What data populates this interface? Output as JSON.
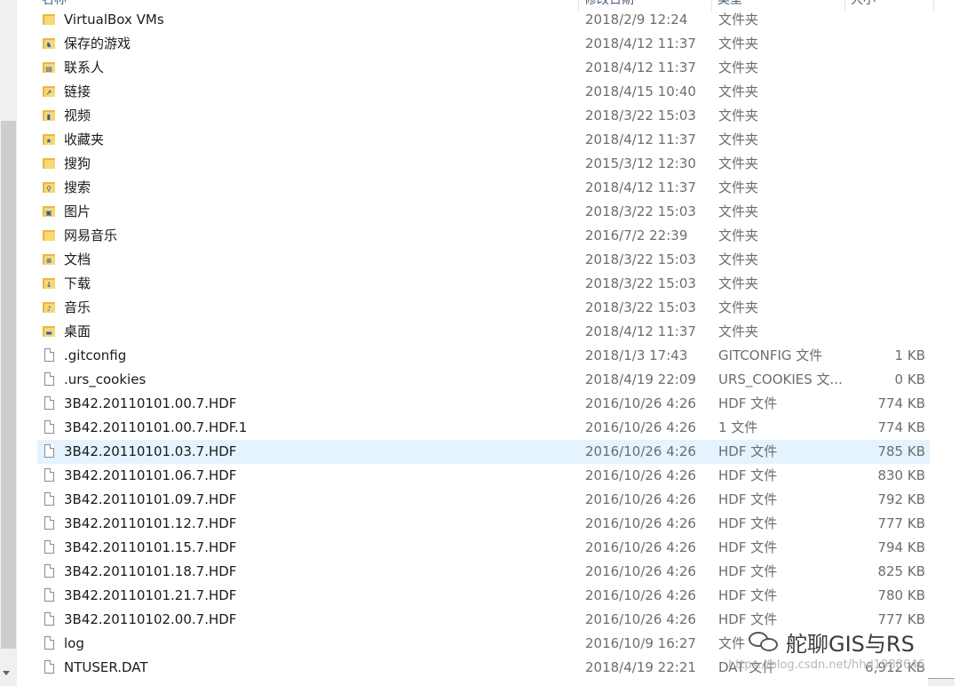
{
  "header": {
    "name": "名称",
    "date": "修改日期",
    "type": "类型",
    "size": "大小"
  },
  "rows": [
    {
      "name": "VirtualBox VMs",
      "date": "2018/2/9 12:24",
      "type": "文件夹",
      "size": "",
      "icon": "folder-icon"
    },
    {
      "name": "保存的游戏",
      "date": "2018/4/12 11:37",
      "type": "文件夹",
      "size": "",
      "icon": "saved-games-folder-icon"
    },
    {
      "name": "联系人",
      "date": "2018/4/12 11:37",
      "type": "文件夹",
      "size": "",
      "icon": "contacts-folder-icon"
    },
    {
      "name": "链接",
      "date": "2018/4/15 10:40",
      "type": "文件夹",
      "size": "",
      "icon": "links-folder-icon"
    },
    {
      "name": "视频",
      "date": "2018/3/22 15:03",
      "type": "文件夹",
      "size": "",
      "icon": "videos-folder-icon"
    },
    {
      "name": "收藏夹",
      "date": "2018/4/12 11:37",
      "type": "文件夹",
      "size": "",
      "icon": "favorites-folder-icon"
    },
    {
      "name": "搜狗",
      "date": "2015/3/12 12:30",
      "type": "文件夹",
      "size": "",
      "icon": "folder-icon"
    },
    {
      "name": "搜索",
      "date": "2018/4/12 11:37",
      "type": "文件夹",
      "size": "",
      "icon": "searches-folder-icon"
    },
    {
      "name": "图片",
      "date": "2018/3/22 15:03",
      "type": "文件夹",
      "size": "",
      "icon": "pictures-folder-icon"
    },
    {
      "name": "网易音乐",
      "date": "2016/7/2 22:39",
      "type": "文件夹",
      "size": "",
      "icon": "folder-icon"
    },
    {
      "name": "文档",
      "date": "2018/3/22 15:03",
      "type": "文件夹",
      "size": "",
      "icon": "documents-folder-icon"
    },
    {
      "name": "下载",
      "date": "2018/3/22 15:03",
      "type": "文件夹",
      "size": "",
      "icon": "downloads-folder-icon"
    },
    {
      "name": "音乐",
      "date": "2018/3/22 15:03",
      "type": "文件夹",
      "size": "",
      "icon": "music-folder-icon"
    },
    {
      "name": "桌面",
      "date": "2018/4/12 11:37",
      "type": "文件夹",
      "size": "",
      "icon": "desktop-folder-icon"
    },
    {
      "name": ".gitconfig",
      "date": "2018/1/3 17:43",
      "type": "GITCONFIG 文件",
      "size": "1 KB",
      "icon": "file-icon"
    },
    {
      "name": ".urs_cookies",
      "date": "2018/4/19 22:09",
      "type": "URS_COOKIES 文...",
      "size": "0 KB",
      "icon": "file-icon"
    },
    {
      "name": "3B42.20110101.00.7.HDF",
      "date": "2016/10/26 4:26",
      "type": "HDF 文件",
      "size": "774 KB",
      "icon": "file-icon"
    },
    {
      "name": "3B42.20110101.00.7.HDF.1",
      "date": "2016/10/26 4:26",
      "type": "1 文件",
      "size": "774 KB",
      "icon": "file-icon"
    },
    {
      "name": "3B42.20110101.03.7.HDF",
      "date": "2016/10/26 4:26",
      "type": "HDF 文件",
      "size": "785 KB",
      "icon": "file-icon",
      "selected": true
    },
    {
      "name": "3B42.20110101.06.7.HDF",
      "date": "2016/10/26 4:26",
      "type": "HDF 文件",
      "size": "830 KB",
      "icon": "file-icon"
    },
    {
      "name": "3B42.20110101.09.7.HDF",
      "date": "2016/10/26 4:26",
      "type": "HDF 文件",
      "size": "792 KB",
      "icon": "file-icon"
    },
    {
      "name": "3B42.20110101.12.7.HDF",
      "date": "2016/10/26 4:26",
      "type": "HDF 文件",
      "size": "777 KB",
      "icon": "file-icon"
    },
    {
      "name": "3B42.20110101.15.7.HDF",
      "date": "2016/10/26 4:26",
      "type": "HDF 文件",
      "size": "794 KB",
      "icon": "file-icon"
    },
    {
      "name": "3B42.20110101.18.7.HDF",
      "date": "2016/10/26 4:26",
      "type": "HDF 文件",
      "size": "825 KB",
      "icon": "file-icon"
    },
    {
      "name": "3B42.20110101.21.7.HDF",
      "date": "2016/10/26 4:26",
      "type": "HDF 文件",
      "size": "780 KB",
      "icon": "file-icon"
    },
    {
      "name": "3B42.20110102.00.7.HDF",
      "date": "2016/10/26 4:26",
      "type": "HDF 文件",
      "size": "777 KB",
      "icon": "file-icon"
    },
    {
      "name": "log",
      "date": "2016/10/9 16:27",
      "type": "文件",
      "size": "",
      "icon": "file-icon"
    },
    {
      "name": "NTUSER.DAT",
      "date": "2018/4/19 22:21",
      "type": "DAT 文件",
      "size": "6,912 KB",
      "icon": "file-icon"
    }
  ],
  "watermark": {
    "text": "舵聊GIS与RS",
    "url": "https://blog.csdn.net/hhd1988646",
    "logo_icon": "wechat-logo-icon"
  },
  "colors": {
    "selected_row": "#e5f3ff",
    "folder": "#f8d775",
    "secondary_text": "#6d6d6d"
  }
}
